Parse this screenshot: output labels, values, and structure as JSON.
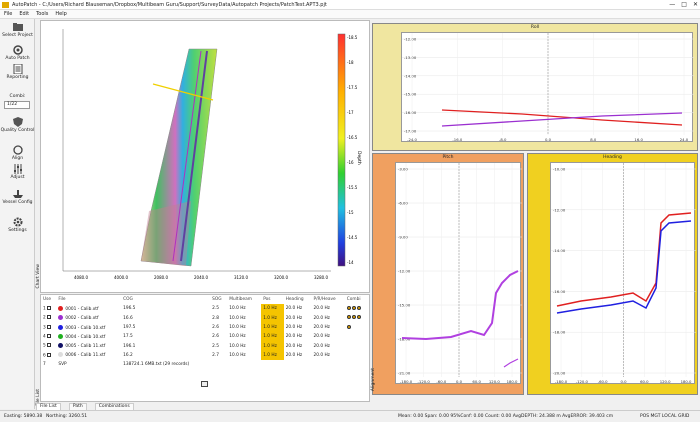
{
  "window": {
    "title": "AutoPatch - C:/Users/Richard Blauseman/Dropbox/Multibeam Guru/Support/SurveyData/Autopatch Projects/PatchTest.APT3.pjt",
    "controls": [
      "—",
      "□",
      "✕"
    ]
  },
  "menu": [
    "File",
    "Edit",
    "Tools",
    "Help"
  ],
  "toolbar": {
    "select_project": "Select Project",
    "auto_patch": "Auto Patch",
    "reporting": "Reporting",
    "combi_label": "Combi:",
    "combi_value": "1/22",
    "quality_control": "Quality Control",
    "align": "Align",
    "adjust": "Adjust",
    "vessel_config": "Vessel Config",
    "settings": "Settings",
    "side_tabs": [
      "Chart View",
      "File List"
    ]
  },
  "map": {
    "colorbar_ticks": [
      "-18.5",
      "-18",
      "-17.5",
      "-17",
      "-16.5",
      "-16",
      "-15.5",
      "-15",
      "-14.5",
      "-14"
    ],
    "colorbar_label": "Depth",
    "x_ticks": [
      "4080.0",
      "4000.0",
      "2080.0",
      "2040.0",
      "3120.0",
      "3200.0",
      "3280.0"
    ],
    "y_ticks": [
      "",
      "",
      "",
      "",
      ""
    ]
  },
  "roll": {
    "title": "Roll",
    "y_ticks": [
      "-12.00",
      "-13.00",
      "-14.00",
      "-15.00",
      "-16.00",
      "-17.00"
    ],
    "x_ticks": [
      "-24.0",
      "-16.0",
      "-8.0",
      "0.0",
      "8.0",
      "16.0",
      "24.0"
    ]
  },
  "pitch": {
    "title": "Pitch",
    "y_ticks": [
      "-3.00",
      "-6.00",
      "-9.00",
      "-12.00",
      "-15.00",
      "-18.00",
      "-21.00"
    ],
    "x_ticks": [
      "-180.0",
      "-120.0",
      "-60.0",
      "0.0",
      "60.0",
      "120.0",
      "180.0"
    ]
  },
  "heading": {
    "title": "Heading",
    "y_ticks": [
      "-10.00",
      "-12.00",
      "-14.00",
      "-16.00",
      "-18.00",
      "-20.00"
    ],
    "x_ticks": [
      "-180.0",
      "-120.0",
      "-60.0",
      "0.0",
      "60.0",
      "120.0",
      "180.0"
    ]
  },
  "file_table": {
    "headers": [
      "Use",
      "File",
      "COG",
      "SOG",
      "Multibeam",
      "Pos",
      "Heading",
      "P/R/Heave",
      "Combi"
    ],
    "rows": [
      {
        "idx": "1",
        "color": "#e02020",
        "file": "0001 - Calib.xtf",
        "cog": "196.5",
        "sog": "2.5",
        "mb": "10.0 Hz",
        "pos": "1.0 Hz",
        "hdg": "20.0 Hz",
        "prh": "20.0 Hz",
        "combi": 3
      },
      {
        "idx": "2",
        "color": "#9b30d0",
        "file": "0002 - Calib.xtf",
        "cog": "16.6",
        "sog": "2.8",
        "mb": "10.0 Hz",
        "pos": "1.0 Hz",
        "hdg": "20.0 Hz",
        "prh": "20.0 Hz",
        "combi": 3
      },
      {
        "idx": "3",
        "color": "#2020e0",
        "file": "0003 - Calib 10.xtf",
        "cog": "197.5",
        "sog": "2.6",
        "mb": "10.0 Hz",
        "pos": "1.0 Hz",
        "hdg": "20.0 Hz",
        "prh": "20.0 Hz",
        "combi": 1
      },
      {
        "idx": "4",
        "color": "#20b020",
        "file": "0004 - Calib 10.xtf",
        "cog": "17.5",
        "sog": "2.6",
        "mb": "10.0 Hz",
        "pos": "1.0 Hz",
        "hdg": "20.0 Hz",
        "prh": "20.0 Hz",
        "combi": 0
      },
      {
        "idx": "5",
        "color": "#111166",
        "file": "0005 - Calib 11.xtf",
        "cog": "196.1",
        "sog": "2.5",
        "mb": "10.0 Hz",
        "pos": "1.0 Hz",
        "hdg": "20.0 Hz",
        "prh": "20.0 Hz",
        "combi": 0
      },
      {
        "idx": "6",
        "color": "#dddddd",
        "file": "0006 - Calib 11.xtf",
        "cog": "16.2",
        "sog": "2.7",
        "mb": "10.0 Hz",
        "pos": "1.0 Hz",
        "hdg": "20.0 Hz",
        "prh": "20.0 Hz",
        "combi": 0
      },
      {
        "idx": "7",
        "color": "",
        "file": "SVP",
        "cog": "138724.1 6MB.txt (29 records)",
        "sog": "",
        "mb": "",
        "pos": "",
        "hdg": "",
        "prh": "",
        "combi": 0
      }
    ]
  },
  "bottom_tabs": [
    "File List",
    "Path",
    "Combinations"
  ],
  "status": {
    "easting": "Easting: 5890.38",
    "northing": "Northing: 3260.51",
    "stats": "Mean: 0.00  Span: 0.00  95%Conf: 0.00  Count: 0.00  AvgDEPTH: 24.388 m  AvgERROR: 39.403 cm",
    "right": "POS MGT  LOCAL GRID"
  }
}
